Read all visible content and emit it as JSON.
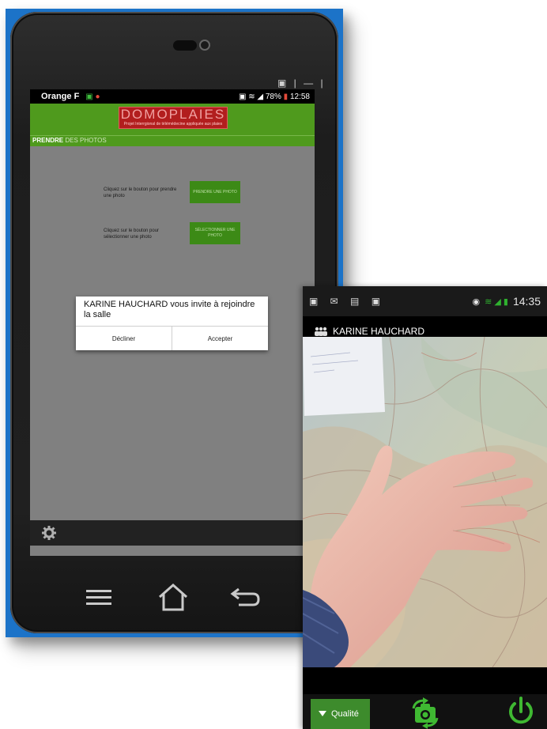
{
  "emulator": {
    "window_controls": "▣ | — | ✕",
    "status_bar": {
      "carrier": "Orange F",
      "battery": "78%",
      "time": "12:58"
    },
    "banner": {
      "logo_title": "DOMOPLAIES",
      "logo_subtitle": "Projet Interrgional de télémédecine appliquée aux plaies"
    },
    "tab": {
      "bold": "PRENDRE",
      "rest": " DES PHOTOS"
    },
    "actions": [
      {
        "text": "Cliquez sur le bouton pour prendre une photo",
        "button": "PRENDRE UNE PHOTO"
      },
      {
        "text": "Cliquez sur le bouton pour sélectionner une photo",
        "button": "SÉLECTIONNER UNE PHOTO"
      }
    ],
    "dialog": {
      "title": "KARINE HAUCHARD vous invite à rejoindre la salle",
      "decline": "Décliner",
      "accept": "Accepter"
    }
  },
  "phone": {
    "status_bar": {
      "time": "14:35"
    },
    "caller_name": "KARINE HAUCHARD",
    "bottom_bar": {
      "quality_label": "Qualité"
    }
  },
  "colors": {
    "emulator_blue": "#1c73c8",
    "banner_green": "#4f9a1d",
    "logo_red": "#b21e1e",
    "button_green": "#3c8a16",
    "quality_green": "#3d8b2c",
    "power_green": "#3fb832"
  },
  "icons": [
    "gear-icon",
    "menu-icon",
    "home-icon",
    "back-icon",
    "people-icon",
    "switch-camera-icon",
    "power-icon",
    "dropdown-triangle-icon"
  ]
}
